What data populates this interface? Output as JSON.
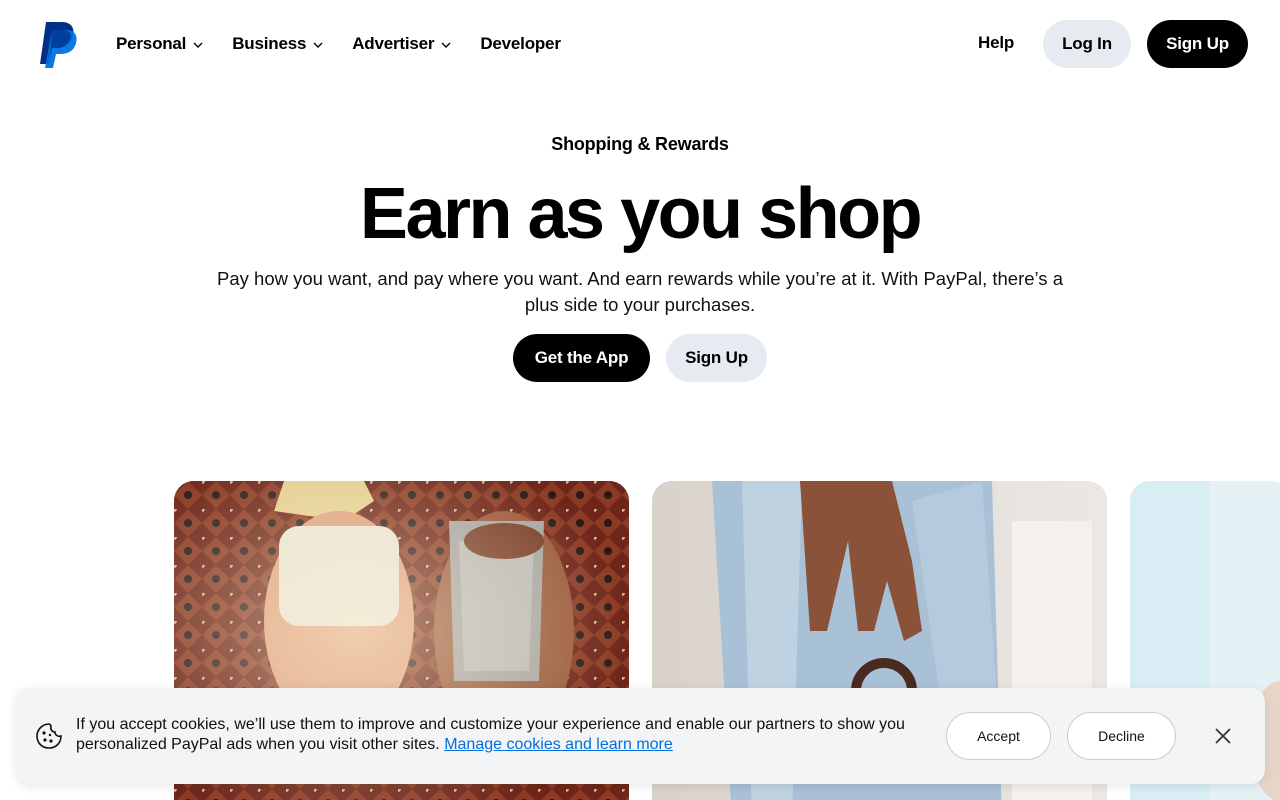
{
  "header": {
    "nav": [
      {
        "label": "Personal",
        "dropdown": true
      },
      {
        "label": "Business",
        "dropdown": true
      },
      {
        "label": "Advertiser",
        "dropdown": true
      },
      {
        "label": "Developer",
        "dropdown": false
      }
    ],
    "help_label": "Help",
    "login_label": "Log In",
    "signup_label": "Sign Up"
  },
  "hero": {
    "eyebrow": "Shopping & Rewards",
    "title": "Earn as you shop",
    "subtitle": "Pay how you want, and pay where you want. And earn rewards while you’re at it. With PayPal, there’s a plus side to your purchases.",
    "primary_cta": "Get the App",
    "secondary_cta": "Sign Up"
  },
  "cookie_banner": {
    "text": "If you accept cookies, we’ll use them to improve and customize your experience and enable our partners to show you personalized PayPal ads when you visit other sites.",
    "link_text": "Manage cookies and learn more",
    "accept_label": "Accept",
    "decline_label": "Decline"
  },
  "colors": {
    "brand_dark_blue": "#003087",
    "brand_blue": "#0070e0",
    "pill_gray": "#e6ebf2",
    "banner_bg": "#f2f4f6"
  },
  "icons": {
    "logo": "paypal-logo",
    "chevron": "chevron-down-icon",
    "cookie": "cookie-icon",
    "close": "close-icon"
  }
}
